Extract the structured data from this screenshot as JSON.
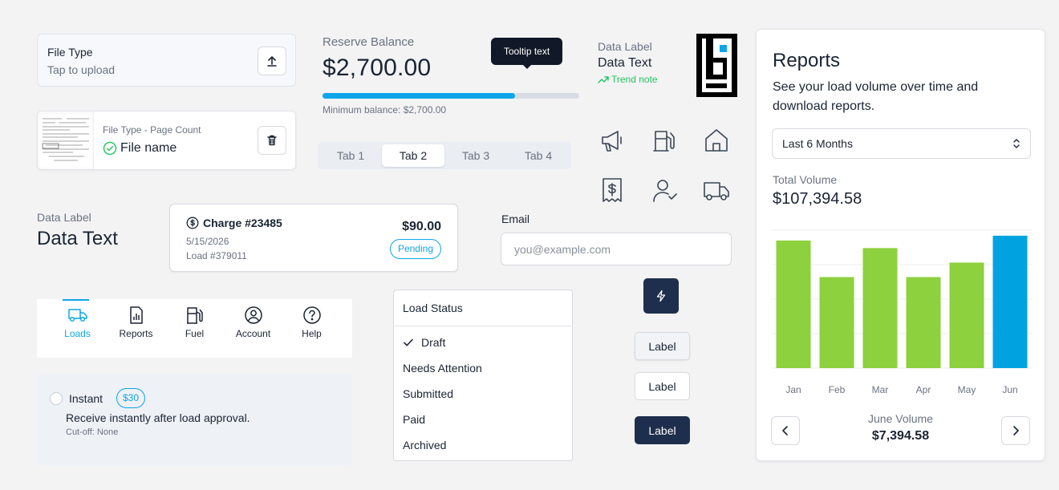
{
  "file_upload": {
    "title": "File Type",
    "hint": "Tap to upload",
    "icon": "upload-icon"
  },
  "file_item": {
    "meta": "File Type - Page Count",
    "name": "File name",
    "icon": "trash-icon"
  },
  "reserve": {
    "label": "Reserve Balance",
    "amount": "$2,700.00",
    "progress": 0.75,
    "min_text": "Minimum balance: $2,700.00",
    "accent": "#0ea5e9"
  },
  "tooltip": {
    "text": "Tooltip text"
  },
  "tabs": {
    "items": [
      "Tab 1",
      "Tab 2",
      "Tab 3",
      "Tab 4"
    ],
    "active_index": 1
  },
  "data_label_top": {
    "label": "Data Label",
    "text": "Data Text",
    "trend": "Trend note",
    "trend_color": "#22c55e"
  },
  "icon_grid": [
    "megaphone-icon",
    "fuel-pump-icon",
    "home-icon",
    "receipt-dollar-icon",
    "user-check-icon",
    "truck-icon"
  ],
  "data_label_left": {
    "label": "Data Label",
    "text": "Data Text"
  },
  "charge": {
    "title": "Charge #23485",
    "date": "5/15/2026",
    "load": "Load #379011",
    "price": "$90.00",
    "status": "Pending"
  },
  "email": {
    "label": "Email",
    "placeholder": "you@example.com",
    "value": ""
  },
  "bottom_nav": {
    "items": [
      "Loads",
      "Reports",
      "Fuel",
      "Account",
      "Help"
    ],
    "active": "Loads"
  },
  "instant": {
    "title": "Instant",
    "fee": "$30",
    "description": "Receive instantly after load approval.",
    "cutoff": "Cut-off: None"
  },
  "load_status": {
    "title": "Load Status",
    "options": [
      "Draft",
      "Needs Attention",
      "Submitted",
      "Paid",
      "Archived"
    ],
    "selected": "Draft"
  },
  "buttons": {
    "icon_button": "bolt-icon",
    "secondary": "Label",
    "outline": "Label",
    "primary": "Label",
    "primary_color": "#1e2f4d"
  },
  "reports": {
    "title": "Reports",
    "subtitle": "See your load volume over time and download reports.",
    "range": "Last 6 Months",
    "total_label": "Total Volume",
    "total": "$107,394.58",
    "selected_label": "June Volume",
    "selected_value": "$7,394.58"
  },
  "chart_data": {
    "type": "bar",
    "categories": [
      "Jan",
      "Feb",
      "Mar",
      "Apr",
      "May",
      "Jun"
    ],
    "values": [
      18500,
      13200,
      17400,
      13200,
      15300,
      19200
    ],
    "ylim": [
      0,
      20000
    ],
    "grid": true,
    "bar_color": "#8dd13f",
    "highlight_color": "#00a3e0",
    "highlight_index": 5
  }
}
